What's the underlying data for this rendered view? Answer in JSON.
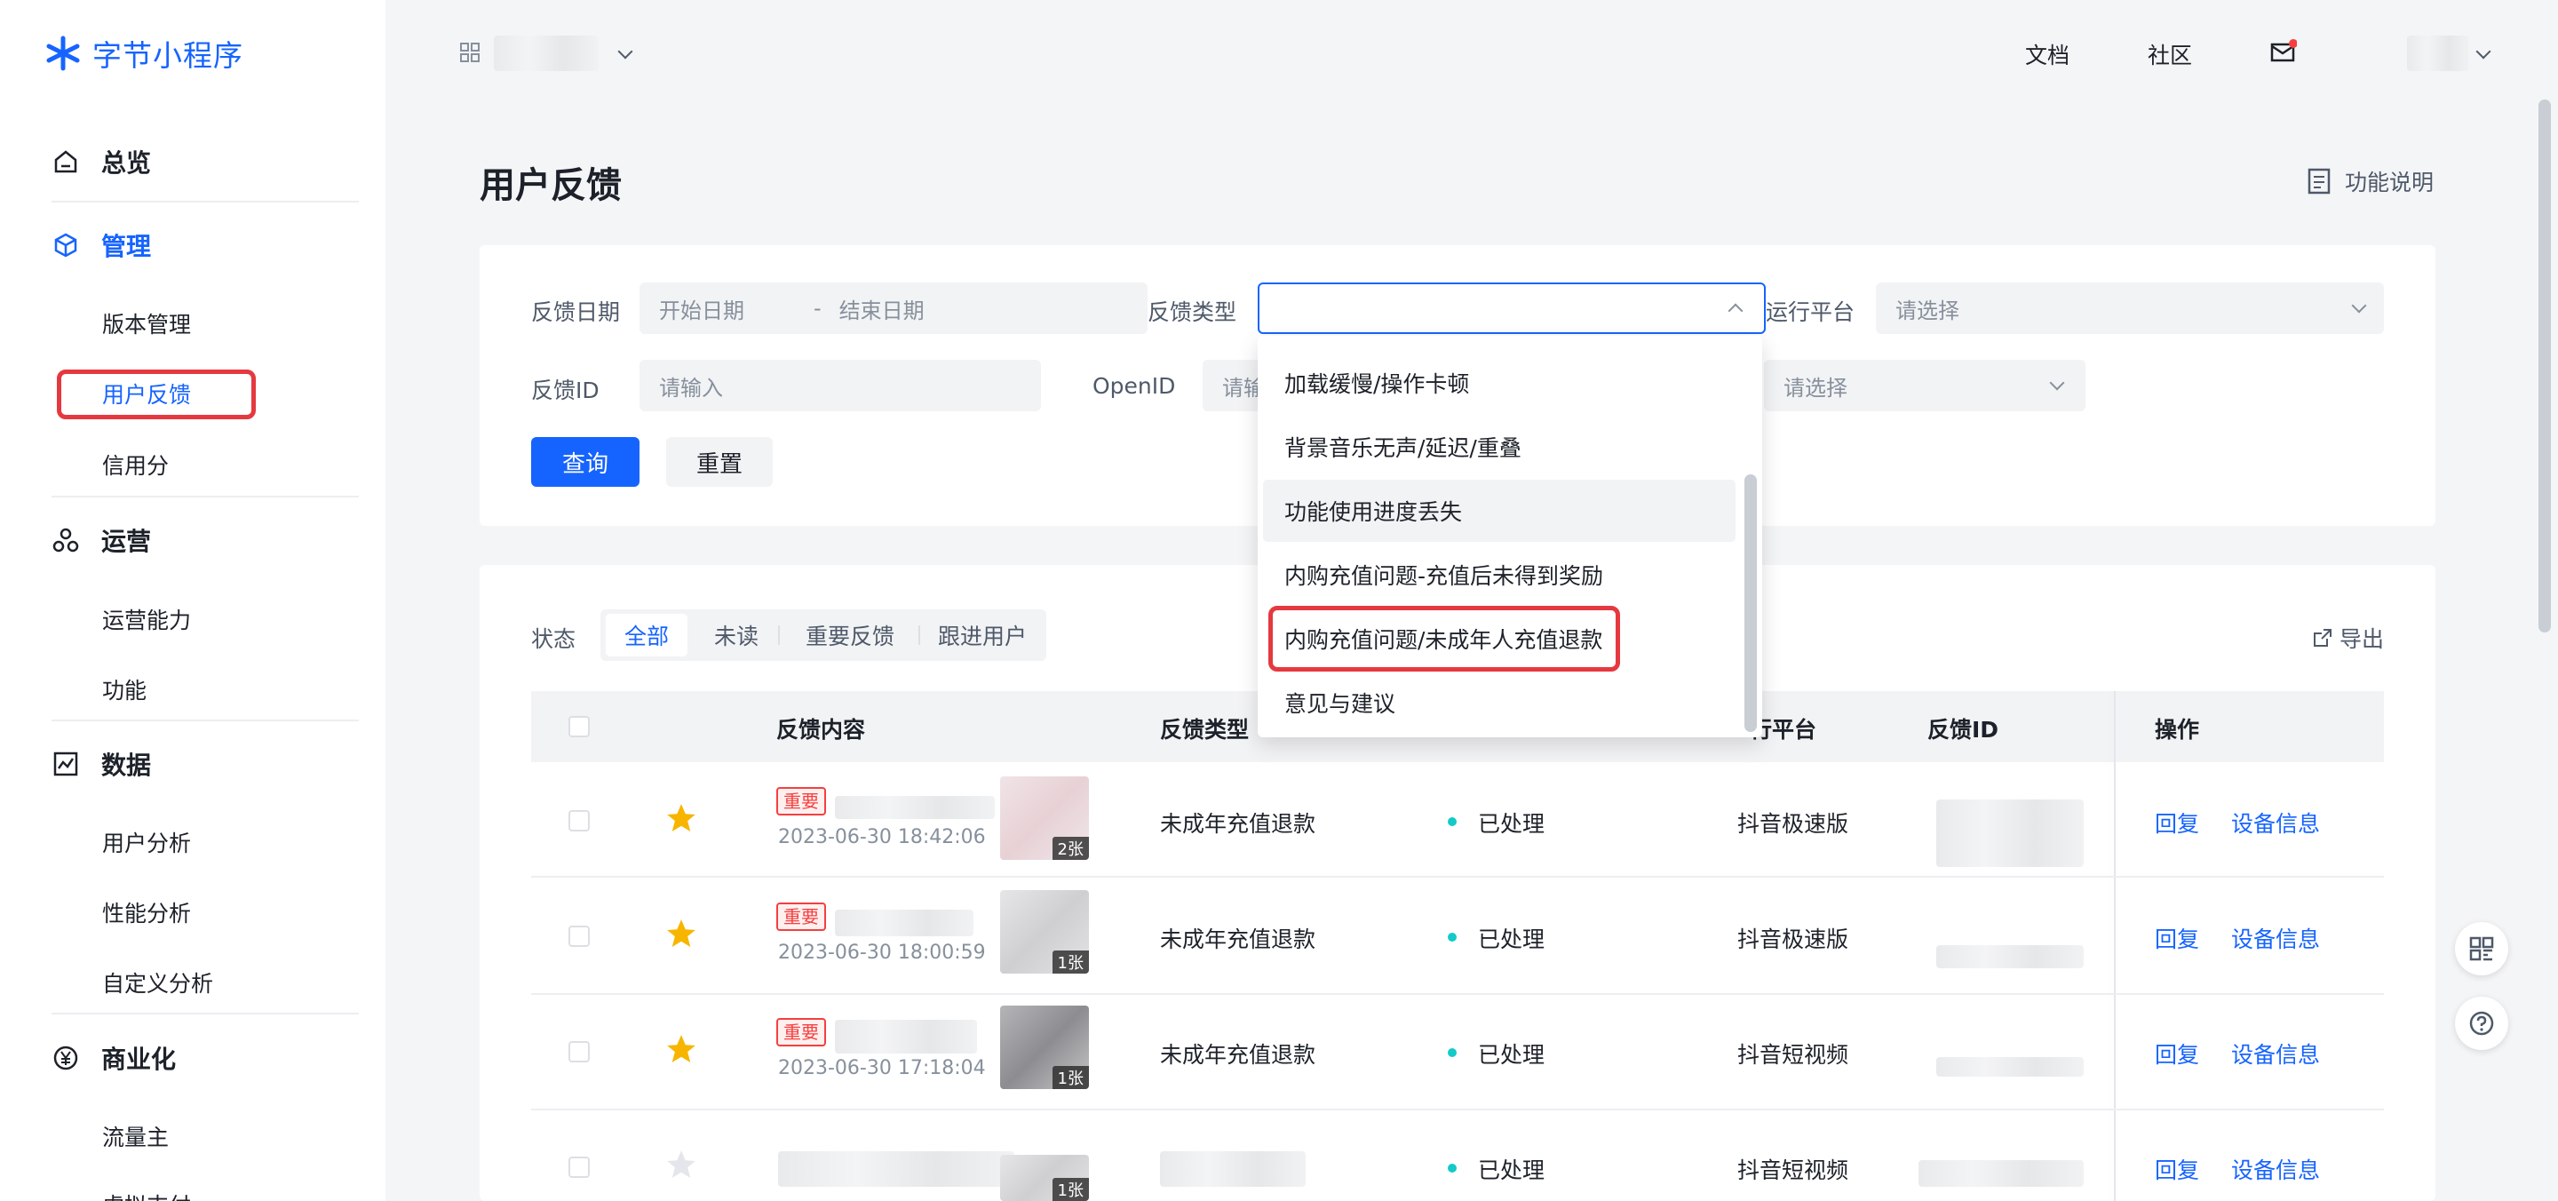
{
  "app": {
    "logo_text": "字节小程序",
    "brand_color": "#1664ff"
  },
  "sidebar": {
    "overview": "总览",
    "manage": "管理",
    "manage_items": [
      "版本管理",
      "用户反馈",
      "信用分"
    ],
    "operation": "运营",
    "operation_items": [
      "运营能力",
      "功能"
    ],
    "data": "数据",
    "data_items": [
      "用户分析",
      "性能分析",
      "自定义分析"
    ],
    "commerce": "商业化",
    "commerce_items": [
      "流量主",
      "虚拟支付"
    ]
  },
  "topbar": {
    "docs": "文档",
    "community": "社区"
  },
  "page": {
    "title": "用户反馈",
    "help": "功能说明"
  },
  "filters": {
    "date_label": "反馈日期",
    "start_placeholder": "开始日期",
    "sep": "-",
    "end_placeholder": "结束日期",
    "type_label": "反馈类型",
    "platform_label": "运行平台",
    "platform_placeholder": "请选择",
    "id_label": "反馈ID",
    "id_placeholder": "请输入",
    "openid_label": "OpenID",
    "openid_placeholder": "请输",
    "select_placeholder": "请选择",
    "query_button": "查询",
    "reset_button": "重置"
  },
  "dropdown": {
    "items": [
      "加载缓慢/操作卡顿",
      "背景音乐无声/延迟/重叠",
      "功能使用进度丢失",
      "内购充值问题-充值后未得到奖励",
      "内购充值问题/未成年人充值退款",
      "意见与建议"
    ],
    "hover_index": 2,
    "highlight_index": 4
  },
  "status": {
    "label": "状态",
    "tabs": [
      "全部",
      "未读",
      "重要反馈",
      "跟进用户"
    ],
    "active": 0,
    "export": "导出"
  },
  "table": {
    "headers": [
      "反馈内容",
      "反馈类型",
      "行平台",
      "反馈ID",
      "操作"
    ],
    "rows": [
      {
        "tag": "重要",
        "time": "2023-06-30 18:42:06",
        "count": "2张",
        "type": "未成年充值退款",
        "status": "已处理",
        "platform": "抖音极速版",
        "reply": "回复",
        "device": "设备信息",
        "starred": true
      },
      {
        "tag": "重要",
        "time": "2023-06-30 18:00:59",
        "count": "1张",
        "type": "未成年充值退款",
        "status": "已处理",
        "platform": "抖音极速版",
        "reply": "回复",
        "device": "设备信息",
        "starred": true
      },
      {
        "tag": "重要",
        "time": "2023-06-30 17:18:04",
        "count": "1张",
        "type": "未成年充值退款",
        "status": "已处理",
        "platform": "抖音短视频",
        "reply": "回复",
        "device": "设备信息",
        "starred": true
      },
      {
        "tag": "",
        "time": "",
        "count": "1张",
        "type": "",
        "status": "已处理",
        "platform": "抖音短视频",
        "reply": "回复",
        "device": "设备信息",
        "starred": false
      }
    ]
  },
  "colors": {
    "primary": "#1664ff",
    "danger": "#f53f3f",
    "status_ok": "#14c9c9",
    "star": "#f7b500",
    "highlight": "#e5393f"
  }
}
